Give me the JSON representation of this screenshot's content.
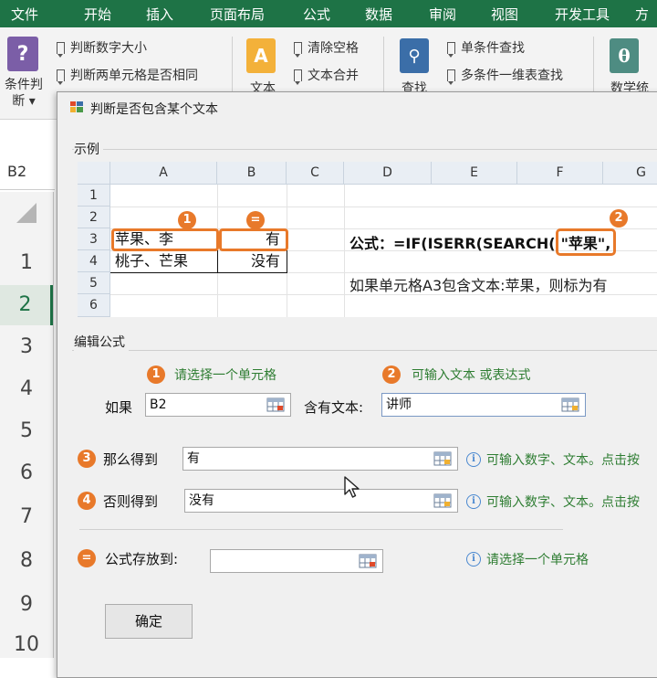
{
  "menu": [
    "文件",
    "开始",
    "插入",
    "页面布局",
    "公式",
    "数据",
    "审阅",
    "视图",
    "开发工具",
    "方"
  ],
  "ribbon": {
    "big1": {
      "l1": "条件判",
      "l2": "断 ▾"
    },
    "group1": [
      "判断数字大小",
      "判断两单元格是否相同"
    ],
    "big2": {
      "l1": "文本"
    },
    "group2": [
      "清除空格",
      "文本合并"
    ],
    "big3": {
      "l1": "查找"
    },
    "group3": [
      "单条件查找",
      "多条件一维表查找"
    ],
    "big4": {
      "l1": "数学统"
    }
  },
  "namebox": "B2",
  "rows": [
    "1",
    "2",
    "3",
    "4",
    "5",
    "6",
    "7",
    "8",
    "9",
    "10"
  ],
  "dialog": {
    "title": "判断是否包含某个文本",
    "example_label": "示例",
    "mini": {
      "cols": [
        "A",
        "B",
        "C",
        "D",
        "E",
        "F",
        "G"
      ],
      "rows": [
        "1",
        "2",
        "3",
        "4",
        "5",
        "6"
      ],
      "a3": "苹果、李",
      "b3": "有",
      "a4": "桃子、芒果",
      "b4": "没有",
      "badge1": "1",
      "badge_eq": "=",
      "badge2": "2",
      "formula_prefix": "公式：=IF(ISERR(SEARCH(",
      "formula_highlight": "\"苹果\",",
      "note": "如果单元格A3包含文本:苹果，则标为有"
    },
    "edit_label": "编辑公式",
    "hint1_num": "1",
    "hint1": "请选择一个单元格",
    "hint2_num": "2",
    "hint2": "可输入文本 或表达式",
    "if_label": "如果",
    "if_value": "B2",
    "contains_label": "含有文本:",
    "contains_value": "讲师",
    "then_num": "3",
    "then_label": "那么得到",
    "then_value": "有",
    "then_info": "可输入数字、文本。点击按",
    "else_num": "4",
    "else_label": "否则得到",
    "else_value": "没有",
    "else_info": "可输入数字、文本。点击按",
    "store_num": "=",
    "store_label": "公式存放到:",
    "store_value": "",
    "store_info": "请选择一个单元格",
    "ok": "确定"
  },
  "colors": {
    "excel_green": "#1e7346",
    "accent_orange": "#e8792a",
    "hint_green": "#2e7d32",
    "info_blue": "#4a88d0"
  }
}
